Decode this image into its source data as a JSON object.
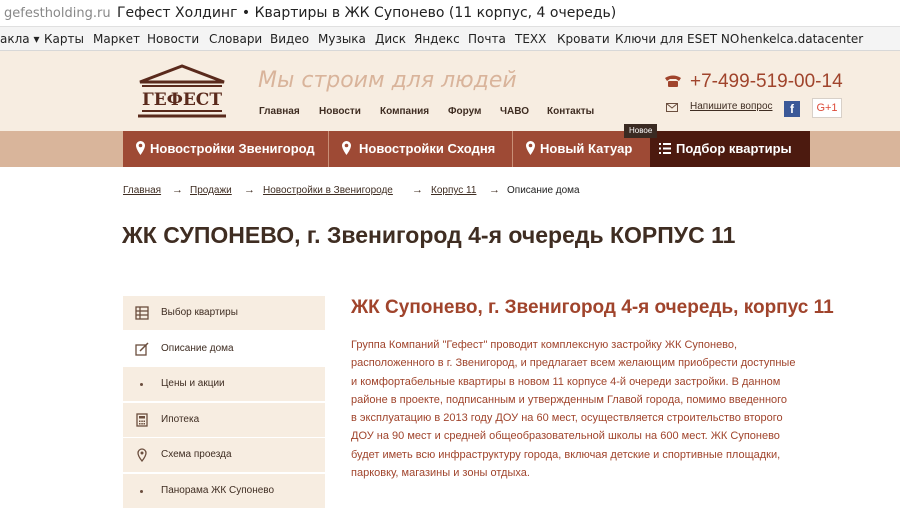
{
  "browser": {
    "domain": "gefestholding.ru",
    "title": "Гефест Холдинг • Квартиры в ЖК Супонево (11 корпус, 4 очередь)"
  },
  "bookmarks": [
    "акла ▾",
    "Карты",
    "Маркет",
    "Новости",
    "Словари",
    "Видео",
    "Музыка",
    "Диск",
    "Яндекс",
    "Почта",
    "ТЕХХ",
    "Кровати",
    "Ключи для ESET NO",
    "henkelca.datacenter"
  ],
  "header": {
    "logo_text": "ГЕФЕСТ",
    "slogan": "Мы строим для людей",
    "phone": "+7-499-519-00-14",
    "ask_question": "Напишите вопрос",
    "facebook": "f",
    "gplus": "G+1",
    "nav": [
      "Главная",
      "Новости",
      "Компания",
      "Форум",
      "ЧАВО",
      "Контакты"
    ]
  },
  "mainnav": {
    "items": [
      "Новостройки Звенигород",
      "Новостройки Сходня",
      "Новый Катуар",
      "Подбор квартиры"
    ],
    "badge": "Новое"
  },
  "breadcrumbs": {
    "links": [
      "Главная",
      "Продажи",
      "Новостройки в Звенигороде",
      "Корпус 11"
    ],
    "current": "Описание дома",
    "separator": "→"
  },
  "page_title": "ЖК СУПОНЕВО, г. Звенигород 4-я очередь КОРПУС 11",
  "sidebar": {
    "items": [
      {
        "label": "Выбор квартиры",
        "icon": "grid-icon"
      },
      {
        "label": "Описание дома",
        "icon": "edit-icon"
      },
      {
        "label": "Цены и акции",
        "icon": "bullet-icon"
      },
      {
        "label": "Ипотека",
        "icon": "calculator-icon"
      },
      {
        "label": "Схема проезда",
        "icon": "map-pin-icon"
      },
      {
        "label": "Панорама ЖК Супонево",
        "icon": "bullet-icon"
      }
    ]
  },
  "content": {
    "heading": "ЖК Супонево, г. Звенигород 4-я очередь, корпус 11",
    "lines": [
      "Группа Компаний \"Гефест\" проводит комплексную застройку ЖК Супонево,",
      "расположенного в г. Звенигород, и предлагает всем желающим приобрести доступные",
      "и комфортабельные квартиры в новом 11 корпусе  4-й очереди застройки. В данном",
      "районе в проекте, подписанным и утвержденным Главой города,  помимо введенного",
      "в эксплуатацию в 2013 году ДОУ на 60 мест, осуществляется строительство второго",
      "ДОУ на 90 мест  и средней общеобразовательной школы на 600 мест. ЖК Супонево",
      "будет иметь всю инфраструктуру города, включая детские и спортивные площадки,",
      "парковку, магазины и зоны отдыха."
    ]
  },
  "colors": {
    "brand_red": "#9e4a35",
    "brand_dark": "#4c1a0f",
    "header_bg": "#f7ede1",
    "text_accent": "#a0442c"
  }
}
